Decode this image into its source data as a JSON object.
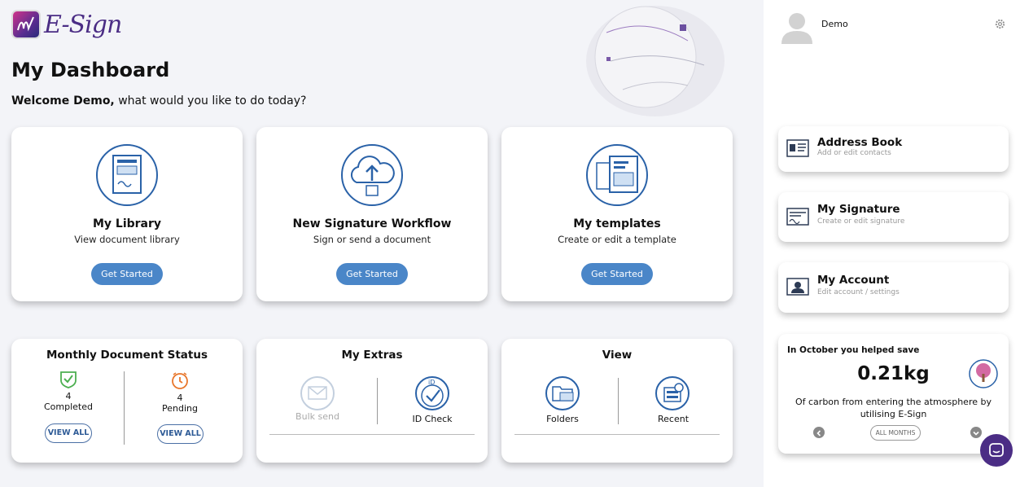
{
  "brand": {
    "logo_text": "E-Sign"
  },
  "header": {
    "title": "My Dashboard",
    "welcome_bold": "Welcome Demo,",
    "welcome_rest": " what would you like to do today?"
  },
  "cards": [
    {
      "title": "My Library",
      "subtitle": "View document library",
      "button": "Get Started",
      "icon": "library-icon"
    },
    {
      "title": "New Signature Workflow",
      "subtitle": "Sign or send a document",
      "button": "Get Started",
      "icon": "cloud-upload-icon"
    },
    {
      "title": "My templates",
      "subtitle": "Create or edit a template",
      "button": "Get Started",
      "icon": "templates-icon"
    }
  ],
  "monthly_status": {
    "title": "Monthly Document Status",
    "completed": {
      "count": "4",
      "label": "Completed",
      "button": "VIEW ALL"
    },
    "pending": {
      "count": "4",
      "label": "Pending",
      "button": "VIEW ALL"
    }
  },
  "extras": {
    "title": "My Extras",
    "items": [
      {
        "label": "Bulk send",
        "disabled": true
      },
      {
        "label": "ID Check",
        "disabled": false
      }
    ]
  },
  "view": {
    "title": "View",
    "items": [
      {
        "label": "Folders"
      },
      {
        "label": "Recent"
      }
    ]
  },
  "user": {
    "name": "Demo"
  },
  "side_menu": [
    {
      "title": "Address Book",
      "subtitle": "Add or edit contacts"
    },
    {
      "title": "My Signature",
      "subtitle": "Create or edit signature"
    },
    {
      "title": "My Account",
      "subtitle": "Edit account / settings"
    }
  ],
  "carbon": {
    "heading": "In October you helped save",
    "value": "0.21kg",
    "description": "Of carbon from entering the atmosphere by utilising E-Sign",
    "filter_button": "ALL MONTHS"
  },
  "colors": {
    "accent": "#4a86c8",
    "brand": "#4b2d85",
    "icon_blue": "#2a62a8",
    "completed": "#4caf50",
    "pending": "#e8762b"
  }
}
